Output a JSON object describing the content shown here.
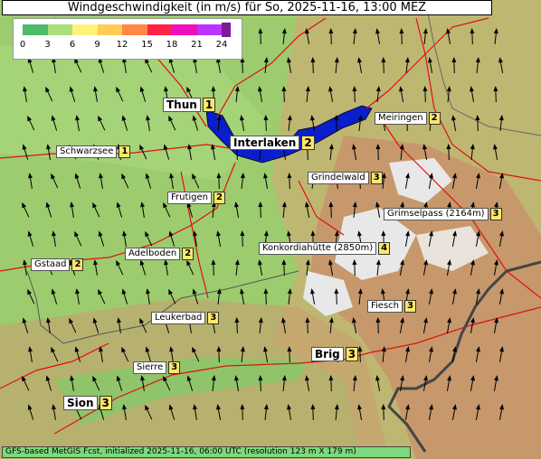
{
  "title": "Windgeschwindigkeit (in m/s) für So, 2025-11-16, 13:00 MEZ",
  "legend": {
    "ticks": [
      "0",
      "3",
      "6",
      "9",
      "12",
      "15",
      "18",
      "21",
      "24"
    ],
    "colors": [
      "#4dbb6a",
      "#aae07a",
      "#fff27a",
      "#ffcc55",
      "#ff8844",
      "#ff2244",
      "#ee11bb",
      "#bb33ff",
      "#7a1a99"
    ]
  },
  "footer": "GFS-based MetGIS Fcst, initialized 2025-11-16, 06:00 UTC  (resolution 123 m X 179 m)",
  "places": [
    {
      "name": "Thun",
      "value": "1",
      "big": true
    },
    {
      "name": "Interlaken",
      "value": "2",
      "big": true
    },
    {
      "name": "Meiringen",
      "value": "2"
    },
    {
      "name": "Schwarzsee",
      "value": "1"
    },
    {
      "name": "Grindelwald",
      "value": "3"
    },
    {
      "name": "Frutigen",
      "value": "2"
    },
    {
      "name": "Grimselpass (2164m)",
      "value": "3"
    },
    {
      "name": "Adelboden",
      "value": "2"
    },
    {
      "name": "Konkordiahütte (2850m)",
      "value": "4"
    },
    {
      "name": "Gstaad",
      "value": "2"
    },
    {
      "name": "Fiesch",
      "value": "3"
    },
    {
      "name": "Leukerbad",
      "value": "3"
    },
    {
      "name": "Brig",
      "value": "3",
      "big": true
    },
    {
      "name": "Sierre",
      "value": "3"
    },
    {
      "name": "Sion",
      "value": "3",
      "big": true
    }
  ],
  "colors": {
    "lake": "#0a1ecc",
    "road": "#e01010",
    "border": "#444444",
    "rock": "#e8e8e8"
  }
}
